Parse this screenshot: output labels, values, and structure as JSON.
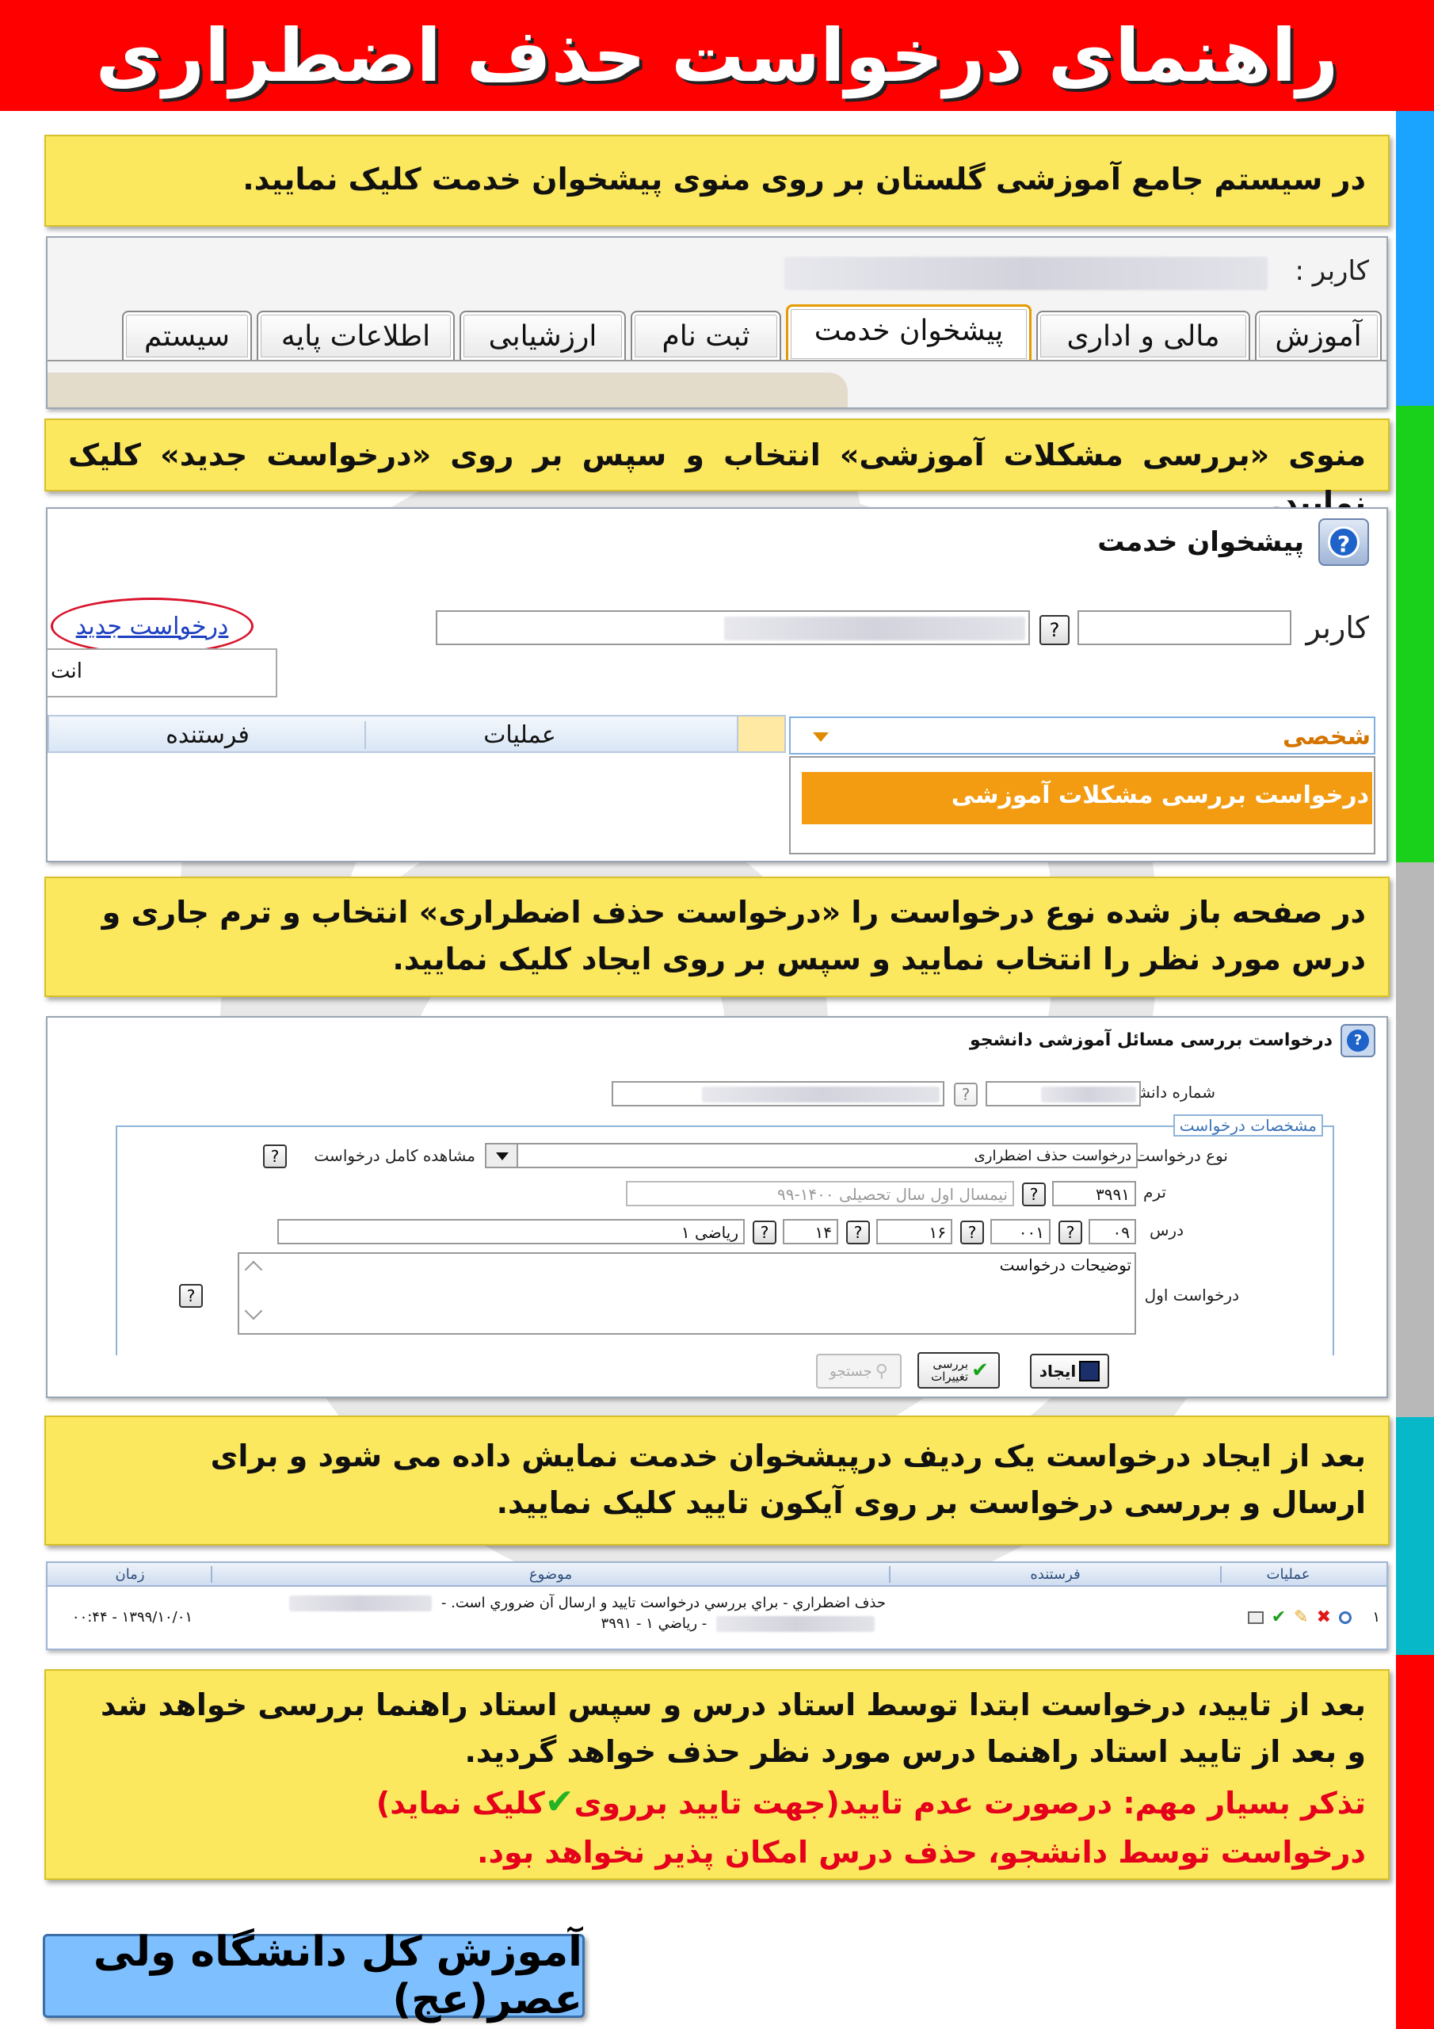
{
  "header": {
    "title": "راهنمای درخواست حذف اضطراری"
  },
  "colors": {
    "header_bg": "#ff0000",
    "note_bg": "#fce85e",
    "important_text": "#e5001b",
    "footer_bg": "#7ec0ff",
    "active_tab_border": "#e69a00",
    "stripe": [
      "#1aa3ff",
      "#19d11a",
      "#b8b8b8",
      "#07b8c9",
      "#ff0000"
    ]
  },
  "steps": [
    {
      "text": "در سیستم جامع آموزشی گلستان بر روی منوی پیشخوان خدمت کلیک نمایید."
    },
    {
      "text": "منوی «بررسی مشکلات آموزشی» انتخاب و سپس بر روی «درخواست جدید» کلیک نمایید."
    },
    {
      "line1": "در صفحه باز شده نوع درخواست را «درخواست حذف اضطراری» انتخاب و ترم جاری و",
      "line2": "درس مورد نظر را انتخاب نمایید و سپس بر روی ایجاد کلیک نمایید."
    },
    {
      "line1": "بعد از ایجاد درخواست یک ردیف درپیشخوان خدمت نمایش داده می شود و برای",
      "line2": "ارسال و بررسی درخواست بر روی آیکون تایید کلیک نمایید."
    },
    {
      "line1": "بعد از تایید، درخواست ابتدا توسط استاد درس و سپس استاد راهنما بررسی خواهد شد",
      "line2": "و بعد از تایید استاد راهنما درس مورد نظر حذف خواهد گردید.",
      "warn1_a": "تذکر بسیار مهم: درصورت عدم تایید(جهت تایید برروی",
      "warn1_b": "کلیک نماید)",
      "warn2": "درخواست توسط دانشجو، حذف درس امکان پذیر نخواهد بود."
    }
  ],
  "screen1": {
    "user_label": "کاربر :",
    "tabs": [
      "آموزش",
      "مالی و اداری",
      "پیشخوان خدمت",
      "ثبت نام",
      "ارزشیابی",
      "اطلاعات پایه",
      "سیستم"
    ],
    "active_tab": "پیشخوان خدمت"
  },
  "screen2": {
    "title": "پیشخوان خدمت",
    "help_icon": "question-circle-icon",
    "user_label": "کاربر",
    "q": "?",
    "new_request_link": "درخواست جدید",
    "partial_text": "انت",
    "dropdown_value": "شخصی",
    "columns": [
      "عملیات",
      "فرستنده"
    ],
    "menu_item": "درخواست بررسی مشکلات آموزشی"
  },
  "screen3": {
    "title": "درخواست بررسی مسائل آموزشی دانشجو",
    "student_no_label": "شماره دانشجو",
    "section_legend": "مشخصات درخواست",
    "request_type_label": "نوع درخواست",
    "request_type_value": "درخواست حذف اضطراری",
    "view_full_label": "مشاهده کامل درخواست",
    "term_label": "ترم",
    "term_code": "۳۹۹۱",
    "term_desc": "نیمسال اول سال تحصیلی ۱۴۰۰-۹۹",
    "course_label": "درس",
    "course_fields": [
      "۰۹",
      "۰۰۱",
      "۱۶",
      "۱۴"
    ],
    "course_name": "ریاضی ۱",
    "desc_placeholder": "توضیحات درخواست",
    "first_request_label": "درخواست اول",
    "btn_create": "ایجاد",
    "btn_review": "بررسی تغییرات",
    "btn_search": "جستجو"
  },
  "screen4": {
    "columns": [
      "عملیات",
      "فرستنده",
      "موضوع",
      "زمان"
    ],
    "row_index": "۱",
    "subject_line1": "حذف اضطراري - براي بررسي درخواست تاييد و ارسال آن ضروري است. -",
    "subject_line2": "- رياضي ۱ - ۳۹۹۱",
    "time": "۱۳۹۹/۱۰/۰۱ - ۰۰:۴۴",
    "op_icons": [
      "search-icon",
      "delete-icon",
      "edit-icon",
      "approve-icon",
      "print-icon"
    ]
  },
  "footer": {
    "text": "آموزش کل دانشگاه ولی عصر(عج)"
  }
}
